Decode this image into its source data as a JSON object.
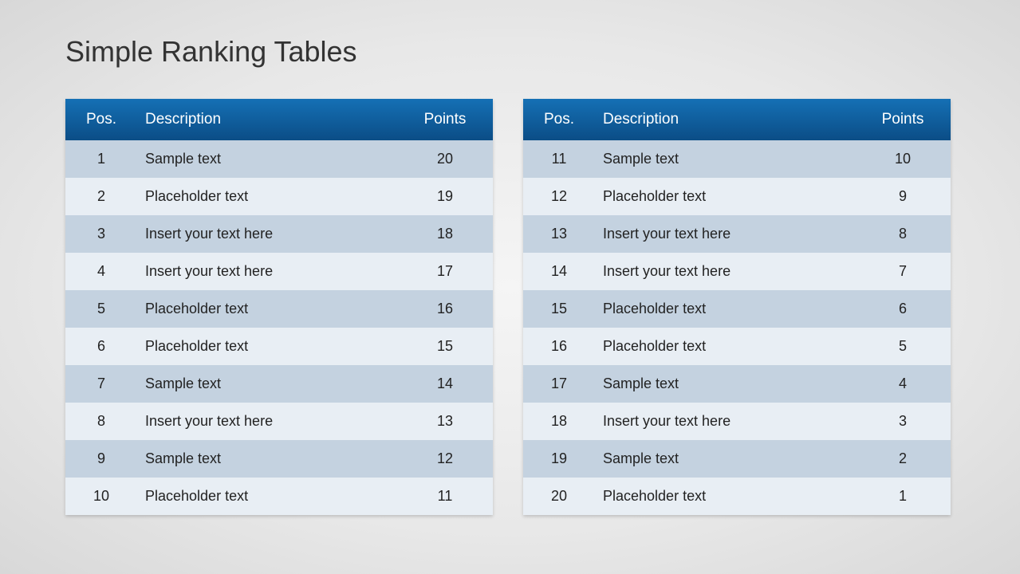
{
  "title": "Simple Ranking Tables",
  "headers": {
    "pos": "Pos.",
    "desc": "Description",
    "points": "Points"
  },
  "tables": [
    {
      "rows": [
        {
          "pos": "1",
          "desc": "Sample text",
          "points": "20"
        },
        {
          "pos": "2",
          "desc": "Placeholder text",
          "points": "19"
        },
        {
          "pos": "3",
          "desc": "Insert your text here",
          "points": "18"
        },
        {
          "pos": "4",
          "desc": "Insert your text here",
          "points": "17"
        },
        {
          "pos": "5",
          "desc": "Placeholder text",
          "points": "16"
        },
        {
          "pos": "6",
          "desc": "Placeholder text",
          "points": "15"
        },
        {
          "pos": "7",
          "desc": "Sample text",
          "points": "14"
        },
        {
          "pos": "8",
          "desc": "Insert your text here",
          "points": "13"
        },
        {
          "pos": "9",
          "desc": "Sample text",
          "points": "12"
        },
        {
          "pos": "10",
          "desc": "Placeholder text",
          "points": "11"
        }
      ]
    },
    {
      "rows": [
        {
          "pos": "11",
          "desc": "Sample text",
          "points": "10"
        },
        {
          "pos": "12",
          "desc": "Placeholder text",
          "points": "9"
        },
        {
          "pos": "13",
          "desc": "Insert your text here",
          "points": "8"
        },
        {
          "pos": "14",
          "desc": "Insert your text here",
          "points": "7"
        },
        {
          "pos": "15",
          "desc": "Placeholder text",
          "points": "6"
        },
        {
          "pos": "16",
          "desc": "Placeholder text",
          "points": "5"
        },
        {
          "pos": "17",
          "desc": "Sample text",
          "points": "4"
        },
        {
          "pos": "18",
          "desc": "Insert your text here",
          "points": "3"
        },
        {
          "pos": "19",
          "desc": "Sample text",
          "points": "2"
        },
        {
          "pos": "20",
          "desc": "Placeholder text",
          "points": "1"
        }
      ]
    }
  ]
}
